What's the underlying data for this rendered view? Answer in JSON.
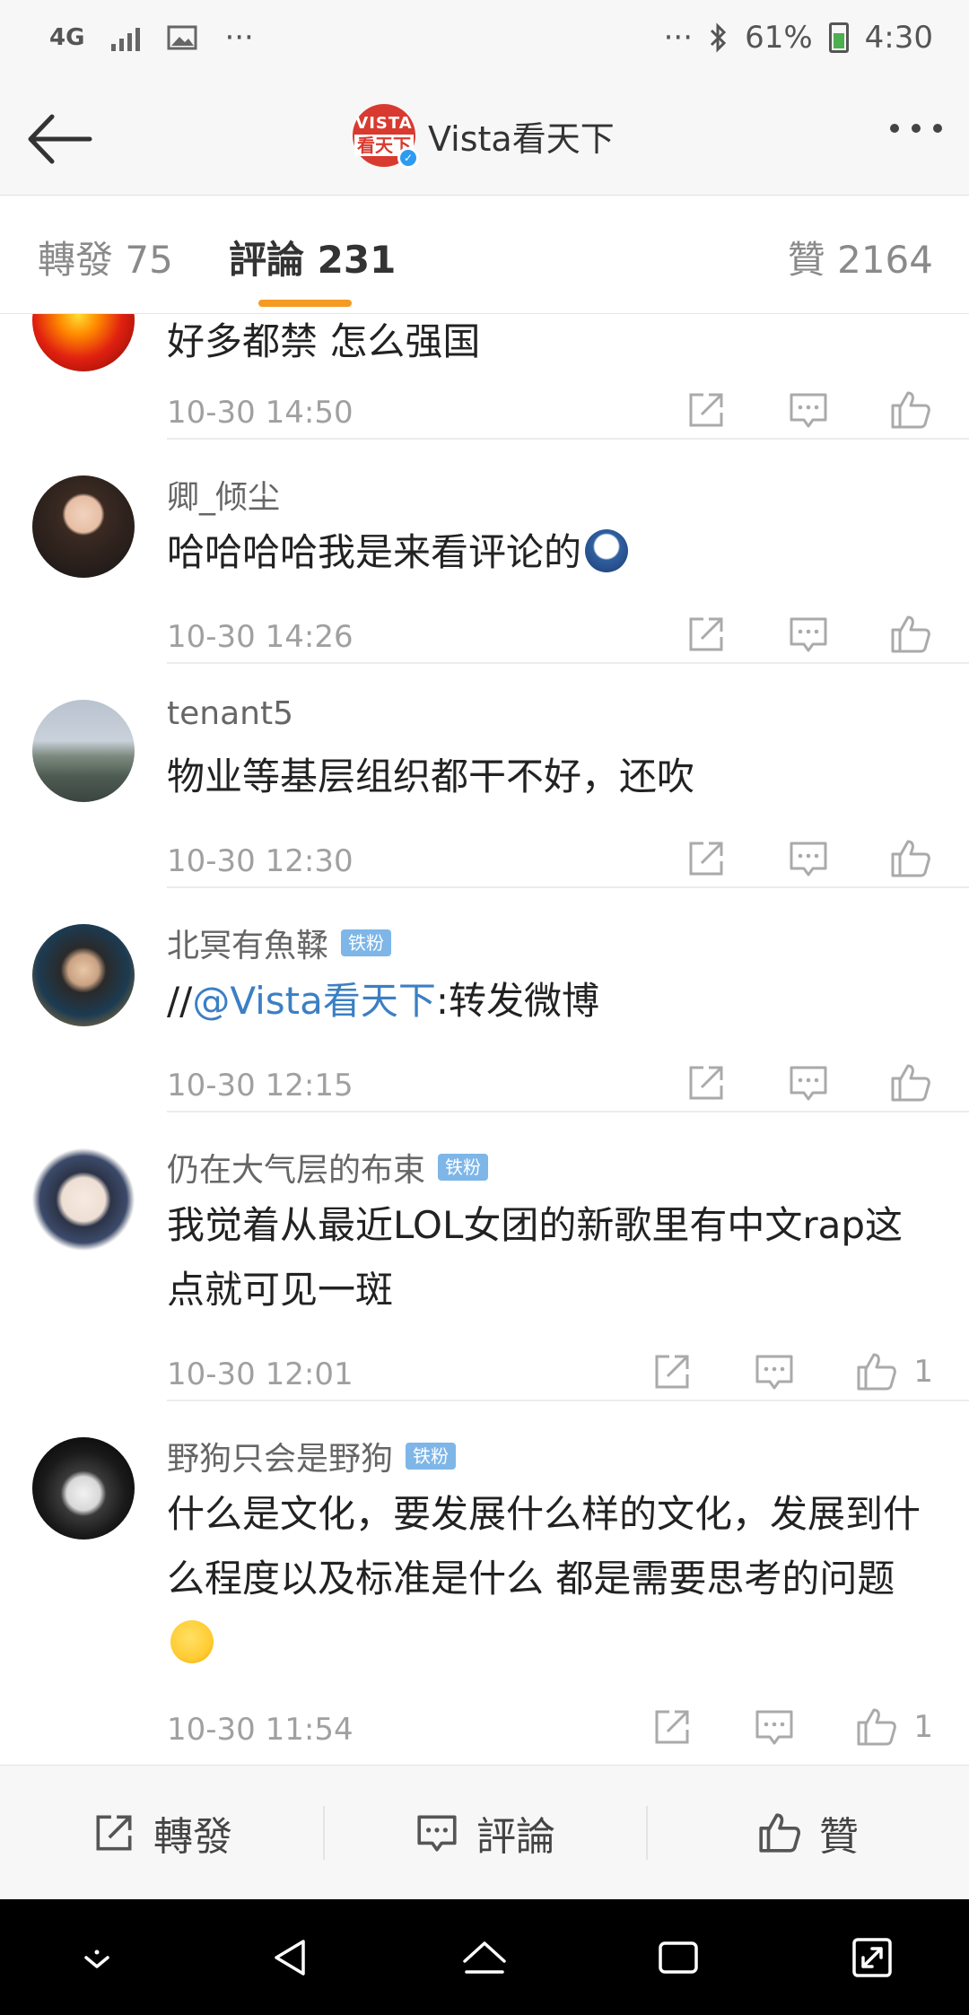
{
  "status_bar": {
    "network": "4G",
    "more": "···",
    "battery": "61%",
    "time": "4:30"
  },
  "header": {
    "logo_text_top": "VISTA",
    "logo_text_bottom": "看天下",
    "title": "Vista看天下"
  },
  "tabs": {
    "repost": "轉發 75",
    "comments": "評論 231",
    "likes": "贊 2164"
  },
  "colors": {
    "accent": "#f59a23",
    "mention": "#3b7fc4",
    "fan_badge": "#7eb6e8"
  },
  "comments": [
    {
      "name": "",
      "badge": "",
      "text": "好多都禁 怎么强国",
      "time": "10-30 14:50",
      "likes": ""
    },
    {
      "name": "卿_倾尘",
      "badge": "",
      "text": "哈哈哈哈我是来看评论的",
      "time": "10-30 14:26",
      "likes": ""
    },
    {
      "name": "tenant5",
      "badge": "",
      "text": "物业等基层组织都干不好，还吹",
      "time": "10-30 12:30",
      "likes": ""
    },
    {
      "name": "北冥有魚鞣",
      "badge": "铁粉",
      "text_prefix": "//",
      "mention": "@Vista看天下",
      "text_suffix": ":转发微博",
      "time": "10-30 12:15",
      "likes": ""
    },
    {
      "name": "仍在大气层的布束",
      "badge": "铁粉",
      "text": "我觉着从最近LOL女团的新歌里有中文rap这点就可见一斑",
      "time": "10-30 12:01",
      "likes": "1"
    },
    {
      "name": "野狗只会是野狗",
      "badge": "铁粉",
      "text": "什么是文化，要发展什么样的文化，发展到什么程度以及标准是什么 都是需要思考的问题",
      "time": "10-30 11:54",
      "likes": "1"
    }
  ],
  "bottom_bar": {
    "repost": "轉發",
    "comment": "評論",
    "like": "贊"
  }
}
